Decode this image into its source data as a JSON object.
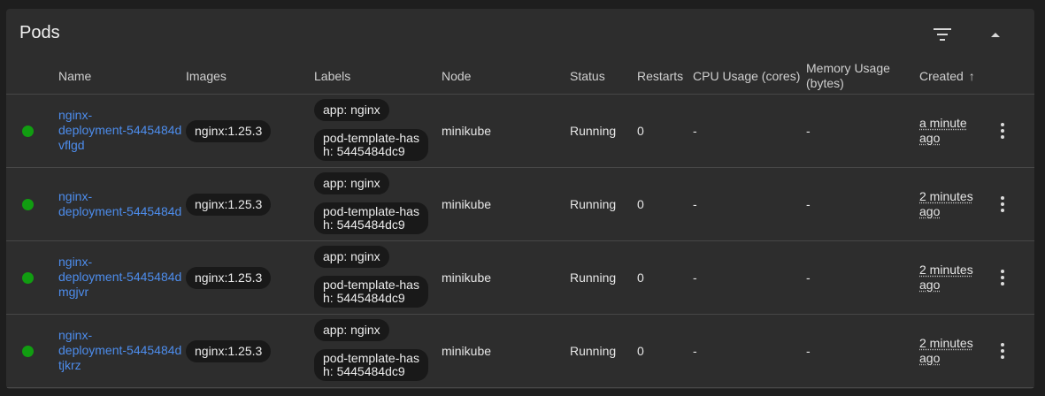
{
  "panel": {
    "title": "Pods"
  },
  "icons": {
    "filter": "filter-list-icon",
    "collapse": "collapse-arrow-icon",
    "more": "more-vert-icon",
    "status": "status-dot-icon",
    "sort": "arrow-up-icon"
  },
  "colors": {
    "running": "#119d11",
    "link": "#4d8ded"
  },
  "columns": {
    "name": "Name",
    "images": "Images",
    "labels": "Labels",
    "node": "Node",
    "status": "Status",
    "restarts": "Restarts",
    "cpu": "CPU Usage (cores)",
    "memory_line1": "Memory Usage",
    "memory_line2": "(bytes)",
    "created": "Created",
    "created_sort_arrow": "↑"
  },
  "pods": [
    {
      "name_lines": [
        "nginx-",
        "deployment-5445484d",
        "vflgd"
      ],
      "image": "nginx:1.25.3",
      "label1": "app: nginx",
      "label2_line1": "pod-template-has",
      "label2_line2": "h: 5445484dc9",
      "node": "minikube",
      "status": "Running",
      "restarts": "0",
      "cpu": "-",
      "memory": "-",
      "created_line1": "a minute",
      "created_line2": "ago"
    },
    {
      "name_lines": [
        "nginx-",
        "deployment-5445484d"
      ],
      "image": "nginx:1.25.3",
      "label1": "app: nginx",
      "label2_line1": "pod-template-has",
      "label2_line2": "h: 5445484dc9",
      "node": "minikube",
      "status": "Running",
      "restarts": "0",
      "cpu": "-",
      "memory": "-",
      "created_line1": "2 minutes",
      "created_line2": "ago"
    },
    {
      "name_lines": [
        "nginx-",
        "deployment-5445484d",
        "mgjvr"
      ],
      "image": "nginx:1.25.3",
      "label1": "app: nginx",
      "label2_line1": "pod-template-has",
      "label2_line2": "h: 5445484dc9",
      "node": "minikube",
      "status": "Running",
      "restarts": "0",
      "cpu": "-",
      "memory": "-",
      "created_line1": "2 minutes",
      "created_line2": "ago"
    },
    {
      "name_lines": [
        "nginx-",
        "deployment-5445484d",
        "tjkrz"
      ],
      "image": "nginx:1.25.3",
      "label1": "app: nginx",
      "label2_line1": "pod-template-has",
      "label2_line2": "h: 5445484dc9",
      "node": "minikube",
      "status": "Running",
      "restarts": "0",
      "cpu": "-",
      "memory": "-",
      "created_line1": "2 minutes",
      "created_line2": "ago"
    }
  ]
}
